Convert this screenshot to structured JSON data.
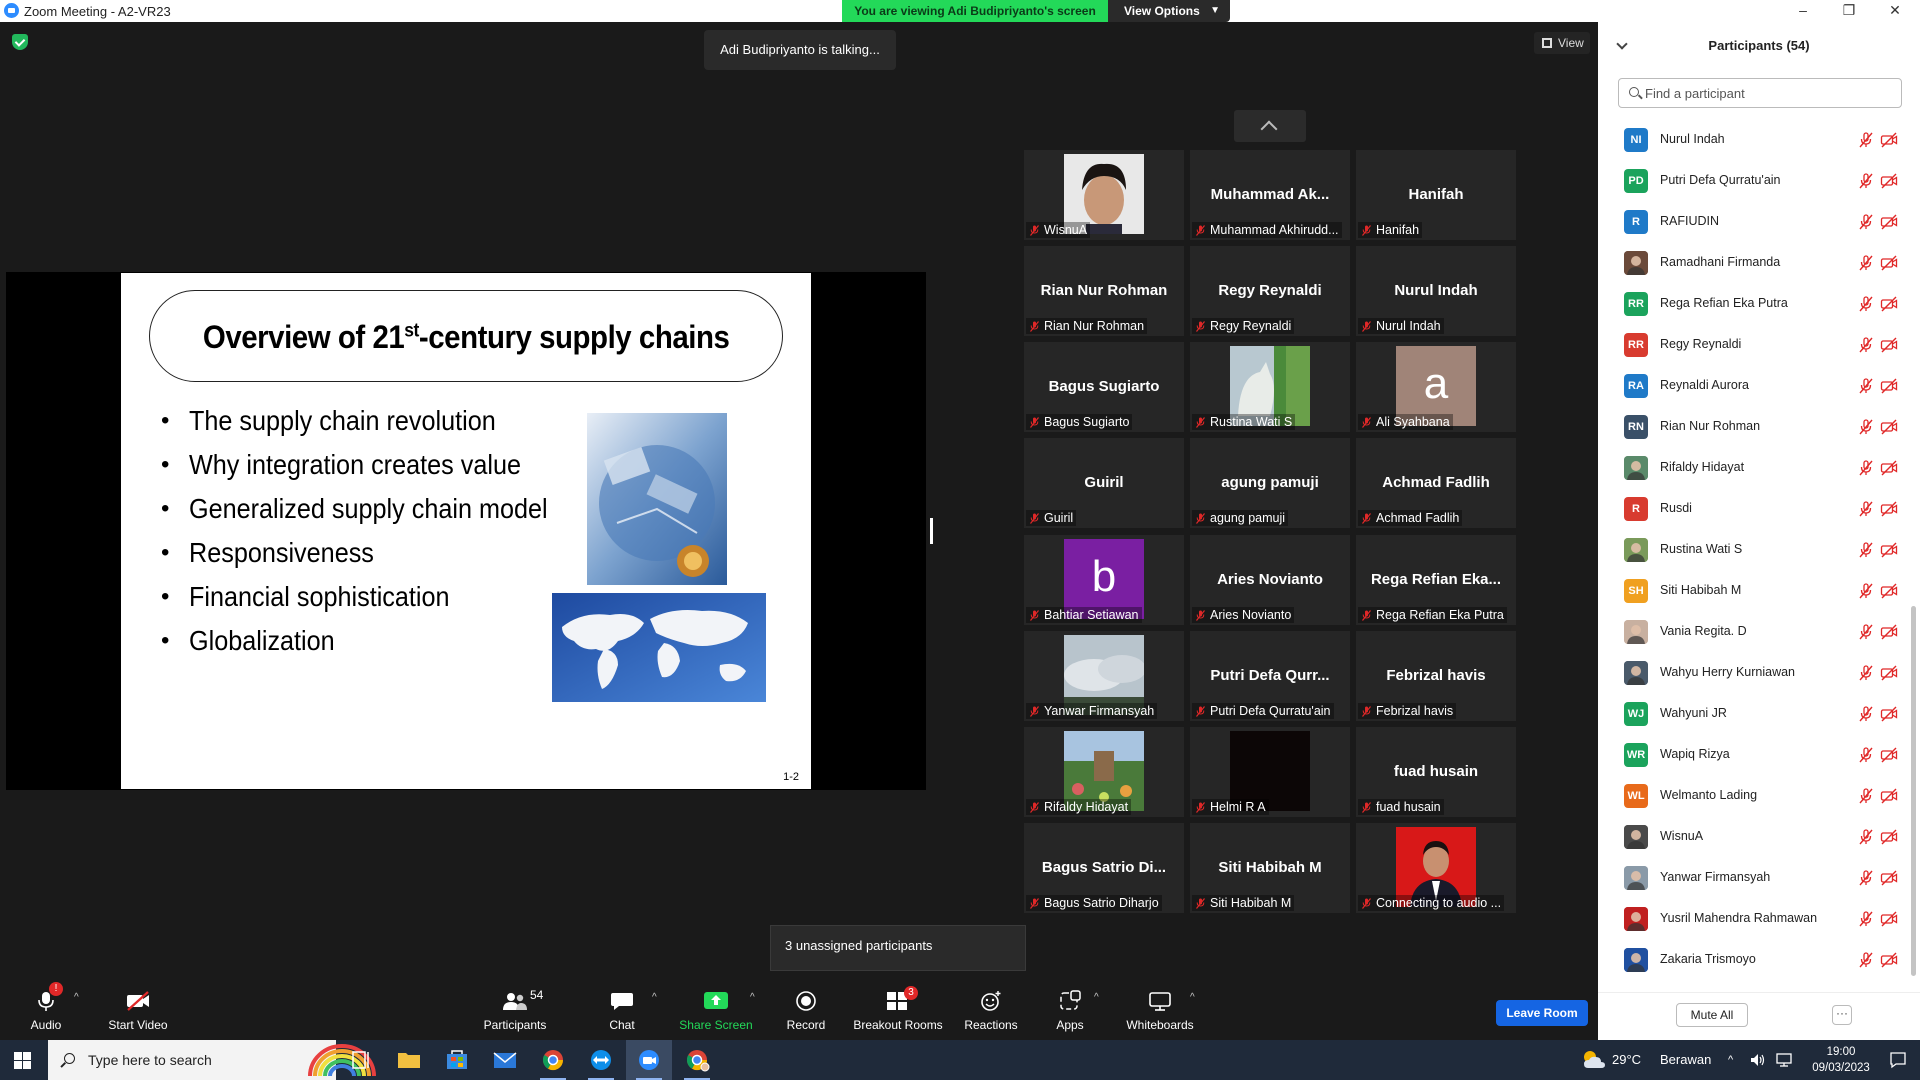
{
  "window": {
    "title": "Zoom Meeting - A2-VR23",
    "min": "–",
    "max": "❐",
    "close": "✕"
  },
  "banner": {
    "viewing": "You are viewing Adi Budipriyanto's screen",
    "view_options": "View Options"
  },
  "talking": "Adi Budipriyanto is talking...",
  "view_label": "View",
  "slide": {
    "title_pre": "Overview of 21",
    "title_sup": "st",
    "title_post": "-century supply chains",
    "bullets": [
      "The supply chain revolution",
      "Why integration creates value",
      "Generalized supply chain model",
      "Responsiveness",
      "Financial sophistication",
      "Globalization"
    ],
    "page_number": "1-2"
  },
  "gallery": [
    {
      "big": "",
      "label": "WisnuA",
      "video": "face-photo"
    },
    {
      "big": "Muhammad  Ak...",
      "label": "Muhammad Akhirudd..."
    },
    {
      "big": "Hanifah",
      "label": "Hanifah"
    },
    {
      "big": "Rian Nur Rohman",
      "label": "Rian Nur Rohman"
    },
    {
      "big": "Regy Reynaldi",
      "label": "Regy Reynaldi"
    },
    {
      "big": "Nurul Indah",
      "label": "Nurul Indah"
    },
    {
      "big": "Bagus Sugiarto",
      "label": "Bagus Sugiarto"
    },
    {
      "big": "",
      "label": "Rustina Wati S",
      "video": "cat-photo"
    },
    {
      "big": "",
      "label": "Ali Syahbana",
      "video": "letter-a"
    },
    {
      "big": "Guiril",
      "label": "Guiril"
    },
    {
      "big": "agung pamuji",
      "label": "agung pamuji"
    },
    {
      "big": "Achmad Fadlih",
      "label": "Achmad Fadlih"
    },
    {
      "big": "",
      "label": "Bahtiar Setiawan",
      "video": "letter-b"
    },
    {
      "big": "Aries Novianto",
      "label": "Aries Novianto"
    },
    {
      "big": "Rega Refian Eka...",
      "label": "Rega Refian Eka Putra"
    },
    {
      "big": "",
      "label": "Yanwar Firmansyah",
      "video": "sky-photo"
    },
    {
      "big": "Putri  Defa  Qurr...",
      "label": "Putri Defa Qurratu'ain"
    },
    {
      "big": "Febrizal havis",
      "label": "Febrizal havis"
    },
    {
      "big": "",
      "label": "Rifaldy Hidayat",
      "video": "park-photo"
    },
    {
      "big": "",
      "label": "Helmi R A",
      "video": "dark"
    },
    {
      "big": "fuad husain",
      "label": "fuad husain"
    },
    {
      "big": "Bagus Satrio Di...",
      "label": "Bagus Satrio Diharjo"
    },
    {
      "big": "Siti Habibah M",
      "label": "Siti Habibah M"
    },
    {
      "big": "",
      "label": "Connecting to audio ...",
      "video": "red-portrait"
    }
  ],
  "letters": {
    "a": "a",
    "b": "b"
  },
  "unassigned": "3 unassigned participants",
  "toolbar": {
    "audio": "Audio",
    "start_video": "Start Video",
    "participants": "Participants",
    "participants_count": "54",
    "chat": "Chat",
    "share_screen": "Share Screen",
    "record": "Record",
    "breakout_rooms": "Breakout Rooms",
    "breakout_badge": "3",
    "audio_badge": "!",
    "reactions": "Reactions",
    "apps": "Apps",
    "whiteboards": "Whiteboards",
    "leave_room": "Leave Room"
  },
  "panel": {
    "title": "Participants (54)",
    "search_placeholder": "Find a participant",
    "participants": [
      {
        "initials": "NI",
        "name": "Nurul Indah",
        "color": "#1f7ac8"
      },
      {
        "initials": "PD",
        "name": "Putri Defa Qurratu'ain",
        "color": "#1ba35c"
      },
      {
        "initials": "R",
        "name": "RAFIUDIN",
        "color": "#1f7ac8"
      },
      {
        "initials": "",
        "name": "Ramadhani Firmanda",
        "color": "#6b4a3a"
      },
      {
        "initials": "RR",
        "name": "Rega Refian Eka Putra",
        "color": "#1ba35c"
      },
      {
        "initials": "RR",
        "name": "Regy Reynaldi",
        "color": "#d83b2f"
      },
      {
        "initials": "RA",
        "name": "Reynaldi Aurora",
        "color": "#1f7ac8"
      },
      {
        "initials": "RN",
        "name": "Rian Nur Rohman",
        "color": "#3a5068"
      },
      {
        "initials": "",
        "name": "Rifaldy Hidayat",
        "color": "#5a8a6a"
      },
      {
        "initials": "R",
        "name": "Rusdi",
        "color": "#d83b2f"
      },
      {
        "initials": "",
        "name": "Rustina Wati S",
        "color": "#7a9a5a"
      },
      {
        "initials": "SH",
        "name": "Siti Habibah M",
        "color": "#f0a020"
      },
      {
        "initials": "",
        "name": "Vania Regita. D",
        "color": "#c8b0a0"
      },
      {
        "initials": "",
        "name": "Wahyu Herry Kurniawan",
        "color": "#4a5a6a"
      },
      {
        "initials": "WJ",
        "name": "Wahyuni JR",
        "color": "#1ba35c"
      },
      {
        "initials": "WR",
        "name": "Wapiq Rizya",
        "color": "#1ba35c"
      },
      {
        "initials": "WL",
        "name": "Welmanto Lading",
        "color": "#e86a1a"
      },
      {
        "initials": "",
        "name": "WisnuA",
        "color": "#4a4a4a"
      },
      {
        "initials": "",
        "name": "Yanwar Firmansyah",
        "color": "#8a9aa8"
      },
      {
        "initials": "",
        "name": "Yusril Mahendra Rahmawan",
        "color": "#c02020"
      },
      {
        "initials": "",
        "name": "Zakaria Trismoyo",
        "color": "#2050a0"
      }
    ],
    "mute_all": "Mute All",
    "more": "···"
  },
  "taskbar": {
    "search_placeholder": "Type here to search",
    "temperature": "29°C",
    "weather": "Berawan",
    "time": "19:00",
    "date": "09/03/2023"
  },
  "colors": {
    "zoom_blue": "#2d8cff",
    "banner_green": "#23d959",
    "share_green": "#23d959",
    "leave_blue": "#1565e3",
    "mute_red": "#e02828"
  }
}
